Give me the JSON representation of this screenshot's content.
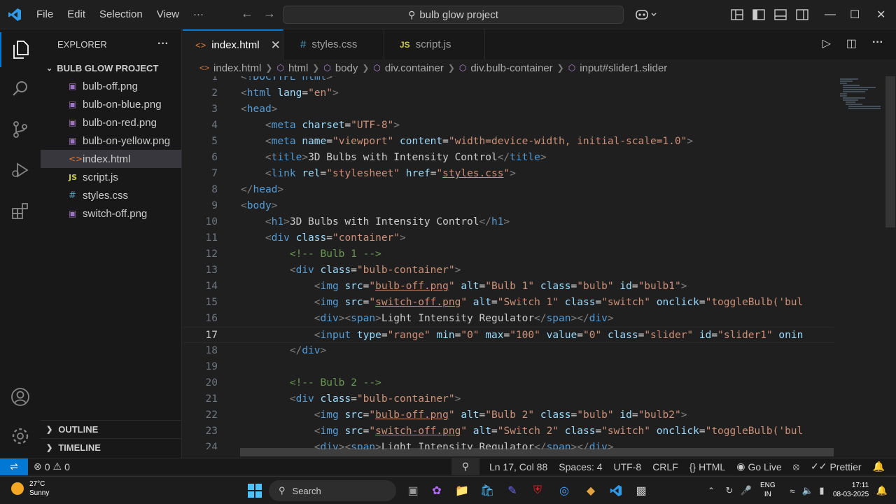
{
  "menu": [
    "File",
    "Edit",
    "Selection",
    "View",
    "···"
  ],
  "command_center": "bulb glow project",
  "sidebar": {
    "title": "EXPLORER",
    "project": "BULB GLOW PROJECT",
    "files": [
      {
        "name": "bulb-off.png",
        "type": "png"
      },
      {
        "name": "bulb-on-blue.png",
        "type": "png"
      },
      {
        "name": "bulb-on-red.png",
        "type": "png"
      },
      {
        "name": "bulb-on-yellow.png",
        "type": "png"
      },
      {
        "name": "index.html",
        "type": "html",
        "selected": true
      },
      {
        "name": "script.js",
        "type": "js"
      },
      {
        "name": "styles.css",
        "type": "css"
      },
      {
        "name": "switch-off.png",
        "type": "png"
      }
    ],
    "outline": "OUTLINE",
    "timeline": "TIMELINE"
  },
  "tabs": [
    {
      "label": "index.html",
      "icon": "<>",
      "active": true
    },
    {
      "label": "styles.css",
      "icon": "#"
    },
    {
      "label": "script.js",
      "icon": "JS"
    }
  ],
  "breadcrumb": [
    "index.html",
    "html",
    "body",
    "div.container",
    "div.bulb-container",
    "input#slider1.slider"
  ],
  "code": {
    "current_line": 17,
    "lines": [
      {
        "n": "1",
        "indent": "",
        "toks": [
          [
            "c-tag",
            "<!DOCTYPE html>"
          ]
        ]
      },
      {
        "n": "2",
        "indent": "",
        "toks": [
          [
            "c-tag",
            "<html "
          ],
          [
            "c-attr",
            "lang"
          ],
          [
            "c-eq",
            "="
          ],
          [
            "c-str",
            "\"en\""
          ],
          [
            "c-tag",
            ">"
          ]
        ]
      },
      {
        "n": "3",
        "indent": "",
        "toks": [
          [
            "c-tag",
            "<head>"
          ]
        ]
      },
      {
        "n": "4",
        "indent": "    ",
        "toks": [
          [
            "c-tag",
            "<meta "
          ],
          [
            "c-attr",
            "charset"
          ],
          [
            "c-eq",
            "="
          ],
          [
            "c-str",
            "\"UTF-8\""
          ],
          [
            "c-tag",
            ">"
          ]
        ]
      },
      {
        "n": "5",
        "indent": "    ",
        "toks": [
          [
            "c-tag",
            "<meta "
          ],
          [
            "c-attr",
            "name"
          ],
          [
            "c-eq",
            "="
          ],
          [
            "c-str",
            "\"viewport\""
          ],
          [
            "c-eq",
            " "
          ],
          [
            "c-attr",
            "content"
          ],
          [
            "c-eq",
            "="
          ],
          [
            "c-str",
            "\"width=device-width, initial-scale=1.0\""
          ],
          [
            "c-tag",
            ">"
          ]
        ]
      },
      {
        "n": "6",
        "indent": "    ",
        "toks": [
          [
            "c-tag",
            "<title>"
          ],
          [
            "c-text",
            "3D Bulbs with Intensity Control"
          ],
          [
            "c-tag",
            "</title>"
          ]
        ]
      },
      {
        "n": "7",
        "indent": "    ",
        "toks": [
          [
            "c-tag",
            "<link "
          ],
          [
            "c-attr",
            "rel"
          ],
          [
            "c-eq",
            "="
          ],
          [
            "c-str",
            "\"stylesheet\""
          ],
          [
            "c-eq",
            " "
          ],
          [
            "c-attr",
            "href"
          ],
          [
            "c-eq",
            "="
          ],
          [
            "c-str",
            "\""
          ],
          [
            "c-link",
            "styles.css"
          ],
          [
            "c-str",
            "\""
          ],
          [
            "c-tag",
            ">"
          ]
        ]
      },
      {
        "n": "8",
        "indent": "",
        "toks": [
          [
            "c-tag",
            "</head>"
          ]
        ]
      },
      {
        "n": "9",
        "indent": "",
        "toks": [
          [
            "c-tag",
            "<body>"
          ]
        ]
      },
      {
        "n": "10",
        "indent": "    ",
        "toks": [
          [
            "c-tag",
            "<h1>"
          ],
          [
            "c-text",
            "3D Bulbs with Intensity Control"
          ],
          [
            "c-tag",
            "</h1>"
          ]
        ]
      },
      {
        "n": "11",
        "indent": "    ",
        "toks": [
          [
            "c-tag",
            "<div "
          ],
          [
            "c-attr",
            "class"
          ],
          [
            "c-eq",
            "="
          ],
          [
            "c-str",
            "\"container\""
          ],
          [
            "c-tag",
            ">"
          ]
        ]
      },
      {
        "n": "12",
        "indent": "        ",
        "toks": [
          [
            "c-comment",
            "<!-- Bulb 1 -->"
          ]
        ]
      },
      {
        "n": "13",
        "indent": "        ",
        "toks": [
          [
            "c-tag",
            "<div "
          ],
          [
            "c-attr",
            "class"
          ],
          [
            "c-eq",
            "="
          ],
          [
            "c-str",
            "\"bulb-container\""
          ],
          [
            "c-tag",
            ">"
          ]
        ]
      },
      {
        "n": "14",
        "indent": "            ",
        "toks": [
          [
            "c-tag",
            "<img "
          ],
          [
            "c-attr",
            "src"
          ],
          [
            "c-eq",
            "="
          ],
          [
            "c-str",
            "\""
          ],
          [
            "c-link",
            "bulb-off.png"
          ],
          [
            "c-str",
            "\""
          ],
          [
            "c-eq",
            " "
          ],
          [
            "c-attr",
            "alt"
          ],
          [
            "c-eq",
            "="
          ],
          [
            "c-str",
            "\"Bulb 1\""
          ],
          [
            "c-eq",
            " "
          ],
          [
            "c-attr",
            "class"
          ],
          [
            "c-eq",
            "="
          ],
          [
            "c-str",
            "\"bulb\""
          ],
          [
            "c-eq",
            " "
          ],
          [
            "c-attr",
            "id"
          ],
          [
            "c-eq",
            "="
          ],
          [
            "c-str",
            "\"bulb1\""
          ],
          [
            "c-tag",
            ">"
          ]
        ]
      },
      {
        "n": "15",
        "indent": "            ",
        "toks": [
          [
            "c-tag",
            "<img "
          ],
          [
            "c-attr",
            "src"
          ],
          [
            "c-eq",
            "="
          ],
          [
            "c-str",
            "\""
          ],
          [
            "c-link",
            "switch-off.png"
          ],
          [
            "c-str",
            "\""
          ],
          [
            "c-eq",
            " "
          ],
          [
            "c-attr",
            "alt"
          ],
          [
            "c-eq",
            "="
          ],
          [
            "c-str",
            "\"Switch 1\""
          ],
          [
            "c-eq",
            " "
          ],
          [
            "c-attr",
            "class"
          ],
          [
            "c-eq",
            "="
          ],
          [
            "c-str",
            "\"switch\""
          ],
          [
            "c-eq",
            " "
          ],
          [
            "c-attr",
            "onclick"
          ],
          [
            "c-eq",
            "="
          ],
          [
            "c-str",
            "\"toggleBulb('bul"
          ]
        ]
      },
      {
        "n": "16",
        "indent": "            ",
        "toks": [
          [
            "c-tag",
            "<div><span>"
          ],
          [
            "c-text",
            "Light Intensity Regulator"
          ],
          [
            "c-tag",
            "</span></div>"
          ]
        ]
      },
      {
        "n": "17",
        "indent": "            ",
        "toks": [
          [
            "c-tag",
            "<input "
          ],
          [
            "c-attr",
            "type"
          ],
          [
            "c-eq",
            "="
          ],
          [
            "c-str",
            "\"range\""
          ],
          [
            "c-eq",
            " "
          ],
          [
            "c-attr",
            "min"
          ],
          [
            "c-eq",
            "="
          ],
          [
            "c-str",
            "\"0\""
          ],
          [
            "c-eq",
            " "
          ],
          [
            "c-attr",
            "max"
          ],
          [
            "c-eq",
            "="
          ],
          [
            "c-str",
            "\"100\""
          ],
          [
            "c-eq",
            " "
          ],
          [
            "c-attr",
            "value"
          ],
          [
            "c-eq",
            "="
          ],
          [
            "c-str",
            "\"0\""
          ],
          [
            "c-eq",
            " "
          ],
          [
            "c-attr",
            "class"
          ],
          [
            "c-eq",
            "="
          ],
          [
            "c-str",
            "\"slider\""
          ],
          [
            "c-eq",
            " "
          ],
          [
            "c-attr",
            "id"
          ],
          [
            "c-eq",
            "="
          ],
          [
            "c-str",
            "\"slider1\""
          ],
          [
            "c-eq",
            " "
          ],
          [
            "c-attr",
            "onin"
          ]
        ]
      },
      {
        "n": "18",
        "indent": "        ",
        "toks": [
          [
            "c-tag",
            "</div>"
          ]
        ]
      },
      {
        "n": "19",
        "indent": "",
        "toks": []
      },
      {
        "n": "20",
        "indent": "        ",
        "toks": [
          [
            "c-comment",
            "<!-- Bulb 2 -->"
          ]
        ]
      },
      {
        "n": "21",
        "indent": "        ",
        "toks": [
          [
            "c-tag",
            "<div "
          ],
          [
            "c-attr",
            "class"
          ],
          [
            "c-eq",
            "="
          ],
          [
            "c-str",
            "\"bulb-container\""
          ],
          [
            "c-tag",
            ">"
          ]
        ]
      },
      {
        "n": "22",
        "indent": "            ",
        "toks": [
          [
            "c-tag",
            "<img "
          ],
          [
            "c-attr",
            "src"
          ],
          [
            "c-eq",
            "="
          ],
          [
            "c-str",
            "\""
          ],
          [
            "c-link",
            "bulb-off.png"
          ],
          [
            "c-str",
            "\""
          ],
          [
            "c-eq",
            " "
          ],
          [
            "c-attr",
            "alt"
          ],
          [
            "c-eq",
            "="
          ],
          [
            "c-str",
            "\"Bulb 2\""
          ],
          [
            "c-eq",
            " "
          ],
          [
            "c-attr",
            "class"
          ],
          [
            "c-eq",
            "="
          ],
          [
            "c-str",
            "\"bulb\""
          ],
          [
            "c-eq",
            " "
          ],
          [
            "c-attr",
            "id"
          ],
          [
            "c-eq",
            "="
          ],
          [
            "c-str",
            "\"bulb2\""
          ],
          [
            "c-tag",
            ">"
          ]
        ]
      },
      {
        "n": "23",
        "indent": "            ",
        "toks": [
          [
            "c-tag",
            "<img "
          ],
          [
            "c-attr",
            "src"
          ],
          [
            "c-eq",
            "="
          ],
          [
            "c-str",
            "\""
          ],
          [
            "c-link",
            "switch-off.png"
          ],
          [
            "c-str",
            "\""
          ],
          [
            "c-eq",
            " "
          ],
          [
            "c-attr",
            "alt"
          ],
          [
            "c-eq",
            "="
          ],
          [
            "c-str",
            "\"Switch 2\""
          ],
          [
            "c-eq",
            " "
          ],
          [
            "c-attr",
            "class"
          ],
          [
            "c-eq",
            "="
          ],
          [
            "c-str",
            "\"switch\""
          ],
          [
            "c-eq",
            " "
          ],
          [
            "c-attr",
            "onclick"
          ],
          [
            "c-eq",
            "="
          ],
          [
            "c-str",
            "\"toggleBulb('bul"
          ]
        ]
      },
      {
        "n": "24",
        "indent": "            ",
        "toks": [
          [
            "c-tag",
            "<div><span>"
          ],
          [
            "c-text",
            "Light Intensity Regulator"
          ],
          [
            "c-tag",
            "</span></div>"
          ]
        ]
      }
    ]
  },
  "statusbar": {
    "errors": "0",
    "warnings": "0",
    "position": "Ln 17, Col 88",
    "spaces": "Spaces: 4",
    "encoding": "UTF-8",
    "eol": "CRLF",
    "language": "HTML",
    "golive": "Go Live",
    "prettier": "Prettier"
  },
  "taskbar": {
    "temp": "27°C",
    "weather": "Sunny",
    "search": "Search",
    "lang1": "ENG",
    "lang2": "IN",
    "time": "17:11",
    "date": "08-03-2025"
  },
  "colors": {
    "accent": "#0078d4",
    "tag": "#808080",
    "tagname": "#569cd6",
    "attr": "#9cdcfe",
    "string": "#ce9178",
    "comment": "#6a9955",
    "text": "#cccccc"
  }
}
